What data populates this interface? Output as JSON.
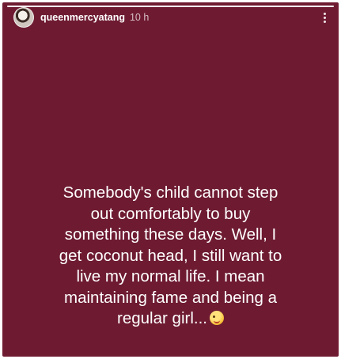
{
  "story": {
    "progress": 1.0,
    "background_color": "#6e1b32",
    "header": {
      "username": "queenmercyatang",
      "timestamp": "10 h",
      "more_icon": "more-vertical-icon"
    },
    "caption": {
      "lines": [
        "Somebody's child cannot step",
        "out comfortably to buy",
        "something these days. Well, I",
        "get coconut head, I still want to",
        "live my normal life. I mean",
        "maintaining fame and being a",
        "regular girl..."
      ],
      "trailing_emoji": "winking-face-with-tongue-emoji"
    }
  }
}
